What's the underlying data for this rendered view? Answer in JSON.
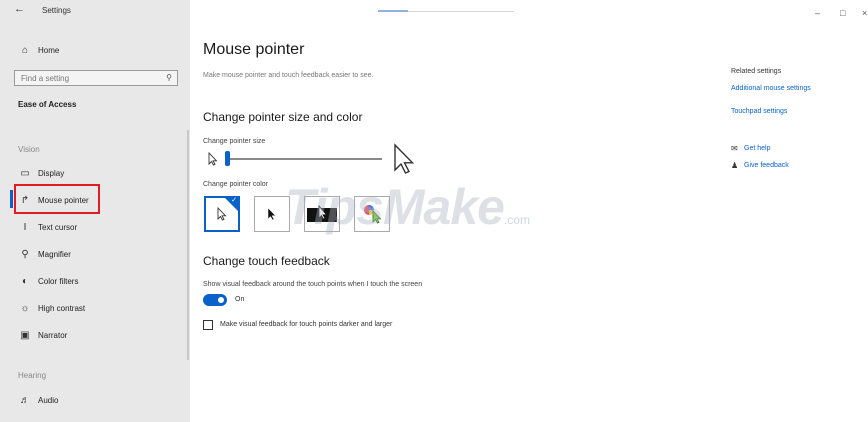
{
  "app": {
    "title": "Settings"
  },
  "sidebar": {
    "home": "Home",
    "search_placeholder": "Find a setting",
    "category": "Ease of Access",
    "vision_label": "Vision",
    "items": [
      {
        "label": "Display",
        "icon": "monitor-icon"
      },
      {
        "label": "Mouse pointer",
        "icon": "mouse-pointer-icon",
        "selected": true
      },
      {
        "label": "Text cursor",
        "icon": "text-cursor-icon"
      },
      {
        "label": "Magnifier",
        "icon": "magnifier-icon"
      },
      {
        "label": "Color filters",
        "icon": "color-filter-icon"
      },
      {
        "label": "High contrast",
        "icon": "high-contrast-icon"
      },
      {
        "label": "Narrator",
        "icon": "narrator-icon"
      }
    ],
    "hearing_label": "Hearing",
    "hearing_items": [
      {
        "label": "Audio",
        "icon": "speaker-icon"
      }
    ]
  },
  "main": {
    "title": "Mouse pointer",
    "description": "Make mouse pointer and touch feedback easier to see.",
    "size_color_heading": "Change pointer size and color",
    "size_label": "Change pointer size",
    "size_value": 1,
    "color_label": "Change pointer color",
    "color_options": [
      "white",
      "black",
      "inverted",
      "custom"
    ],
    "selected_color": "white",
    "touch_heading": "Change touch feedback",
    "touch_desc": "Show visual feedback around the touch points when I touch the screen",
    "toggle_state": "On",
    "checkbox_label": "Make visual feedback for touch points darker and larger",
    "checkbox_checked": false
  },
  "related": {
    "title": "Related settings",
    "links": [
      "Additional mouse settings",
      "Touchpad settings"
    ],
    "help": "Get help",
    "feedback": "Give feedback"
  },
  "watermark": {
    "text": "TipsMake",
    "suffix": ".com"
  },
  "colors": {
    "accent": "#0a62c8",
    "sidebar_bg": "#e8e8e8",
    "highlight": "#e31b23"
  }
}
